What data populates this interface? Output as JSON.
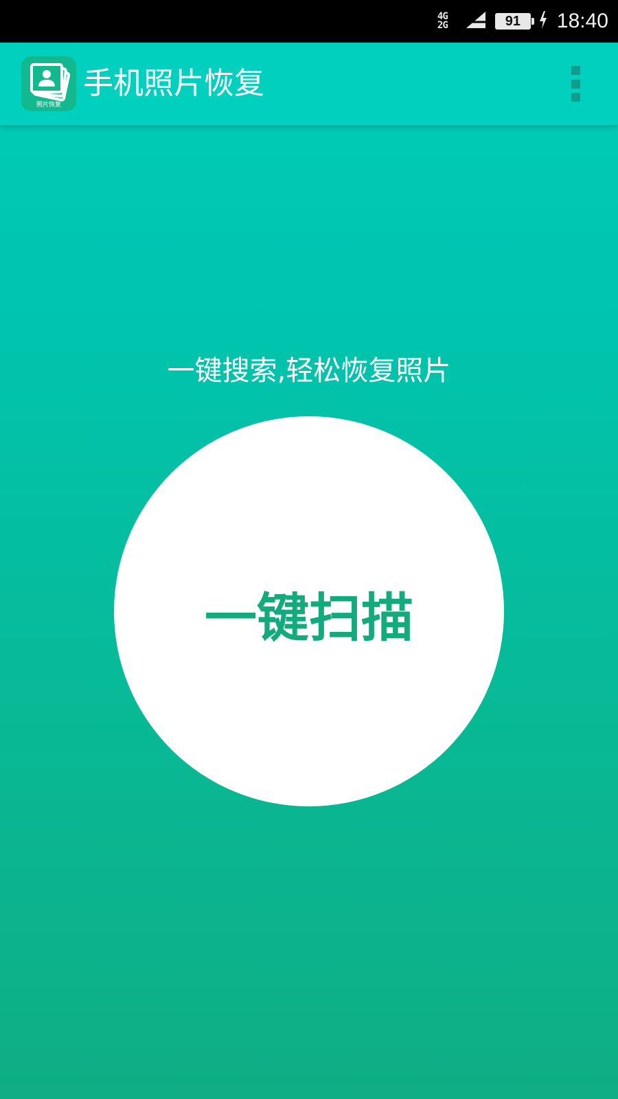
{
  "status_bar": {
    "network": "4G\n2G",
    "battery": "91",
    "time": "18:40"
  },
  "app_bar": {
    "logo_caption": "照片恢复",
    "title": "手机照片恢复",
    "menu_icon": "more-vert-icon"
  },
  "main": {
    "slogan": "一键搜索,轻松恢复照片",
    "scan_button_label": "一键扫描"
  },
  "colors": {
    "status_bar": "#000000",
    "app_bar": "#00d0bd",
    "background_top": "#00cdb8",
    "background_bottom": "#0fae84",
    "scan_text": "#13aa7e",
    "logo_bg": "#12b98e"
  }
}
